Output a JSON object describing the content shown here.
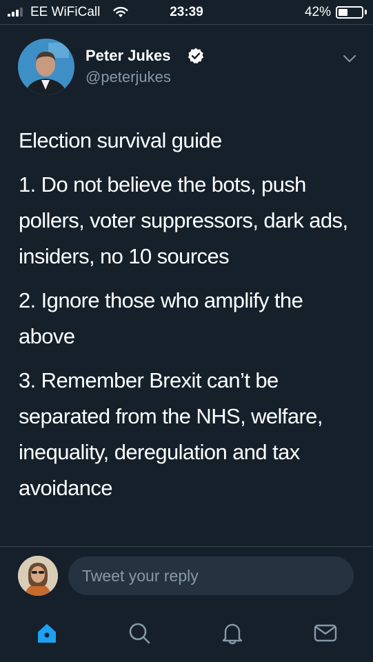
{
  "status_bar": {
    "carrier": "EE WiFiCall",
    "time": "23:39",
    "battery_percent": "42%",
    "battery_level": 0.42
  },
  "tweet": {
    "author_name": "Peter Jukes",
    "author_handle": "@peterjukes",
    "paragraphs": [
      "Election survival guide",
      "1. Do not believe the bots, push pollers, voter suppressors, dark ads, insiders, no 10 sources",
      "2. Ignore those who amplify the above",
      "3. Remember Brexit can’t be separated from the NHS, welfare, inequality, deregulation and tax avoidance"
    ]
  },
  "reply": {
    "placeholder": "Tweet your reply"
  },
  "nav": {
    "items": [
      "home-icon",
      "search-icon",
      "notifications-icon",
      "messages-icon"
    ]
  },
  "colors": {
    "background": "#15202b",
    "accent": "#1da1f2",
    "muted_text": "#8899a6",
    "input_bg": "#253341"
  }
}
